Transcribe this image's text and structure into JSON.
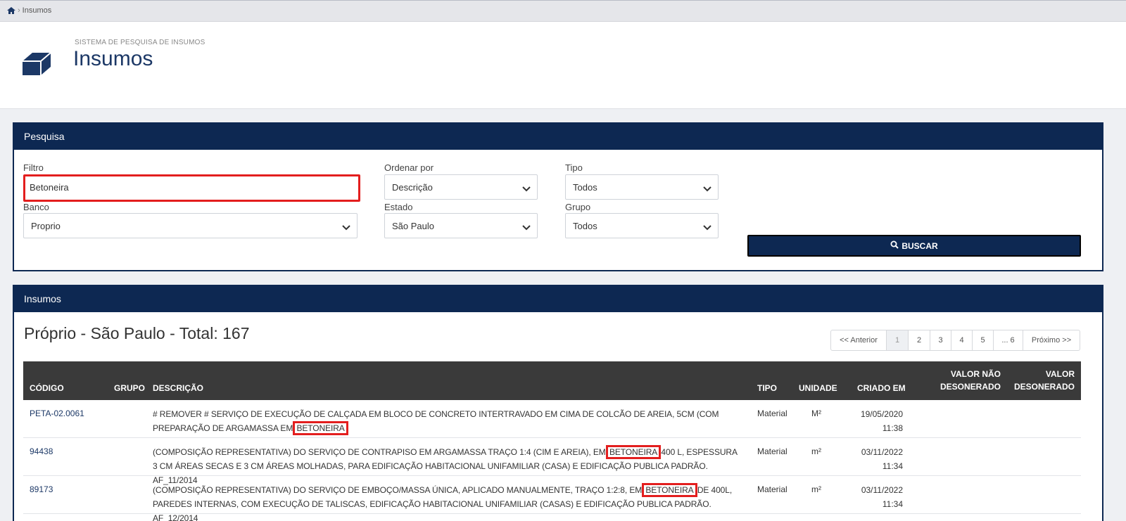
{
  "breadcrumb": {
    "current": "Insumos"
  },
  "header": {
    "subtitle": "SISTEMA DE PESQUISA DE INSUMOS",
    "title": "Insumos"
  },
  "search": {
    "panel_title": "Pesquisa",
    "filtro_label": "Filtro",
    "filtro_value": "Betoneira",
    "ordenar_label": "Ordenar por",
    "ordenar_value": "Descrição",
    "tipo_label": "Tipo",
    "tipo_value": "Todos",
    "banco_label": "Banco",
    "banco_value": "Proprio",
    "estado_label": "Estado",
    "estado_value": "São Paulo",
    "grupo_label": "Grupo",
    "grupo_value": "Todos",
    "buscar_label": "BUSCAR"
  },
  "results": {
    "panel_title": "Insumos",
    "summary": "Próprio - São Paulo - Total: 167",
    "pagination": {
      "prev": "<< Anterior",
      "pages": [
        "1",
        "2",
        "3",
        "4",
        "5",
        "... 6"
      ],
      "next": "Próximo >>",
      "current": "1"
    },
    "columns": {
      "codigo": "CÓDIGO",
      "grupo": "GRUPO",
      "descricao": "DESCRIÇÃO",
      "tipo": "TIPO",
      "unidade": "UNIDADE",
      "criado_em": "CRIADO EM",
      "valor_nao_desonerado_1": "VALOR NÃO",
      "valor_nao_desonerado_2": "DESONERADO",
      "valor_desonerado_1": "VALOR",
      "valor_desonerado_2": "DESONERADO"
    },
    "rows": [
      {
        "codigo": "PETA-02.0061",
        "desc_before": "# REMOVER # SERVIÇO DE EXECUÇÃO DE CALÇADA EM BLOCO DE CONCRETO INTERTRAVADO EM CIMA DE COLCÃO DE AREIA, 5CM (COM PREPARAÇÃO DE ARGAMASSA EM ",
        "desc_highlight": "BETONEIRA",
        "desc_after": "",
        "tipo": "Material",
        "unidade": "M²",
        "data": "19/05/2020",
        "hora": "11:38"
      },
      {
        "codigo": "94438",
        "desc_before": "(COMPOSIÇÃO REPRESENTATIVA) DO SERVIÇO DE CONTRAPISO EM ARGAMASSA TRAÇO 1:4 (CIM E AREIA), EM ",
        "desc_highlight": "BETONEIRA",
        "desc_after": " 400 L, ESPESSURA 3 CM ÁREAS SECAS E 3 CM ÁREAS MOLHADAS, PARA EDIFICAÇÃO HABITACIONAL UNIFAMILIAR (CASA) E EDIFICAÇÃO PUBLICA PADRÃO. AF_11/2014",
        "tipo": "Material",
        "unidade": "m²",
        "data": "03/11/2022",
        "hora": "11:34"
      },
      {
        "codigo": "89173",
        "desc_before": "(COMPOSIÇÃO REPRESENTATIVA) DO SERVIÇO DE EMBOÇO/MASSA ÚNICA, APLICADO MANUALMENTE, TRAÇO 1:2:8, EM ",
        "desc_highlight": "BETONEIRA",
        "desc_after": " DE 400L, PAREDES INTERNAS, COM EXECUÇÃO DE TALISCAS, EDIFICAÇÃO HABITACIONAL UNIFAMILIAR (CASAS) E EDIFICAÇÃO PUBLICA PADRÃO. AF_12/2014",
        "tipo": "Material",
        "unidade": "m²",
        "data": "03/11/2022",
        "hora": "11:34"
      }
    ]
  },
  "colors": {
    "primary": "#0d2852",
    "highlight": "#e31e1e",
    "table_header": "#3a3a3a"
  }
}
